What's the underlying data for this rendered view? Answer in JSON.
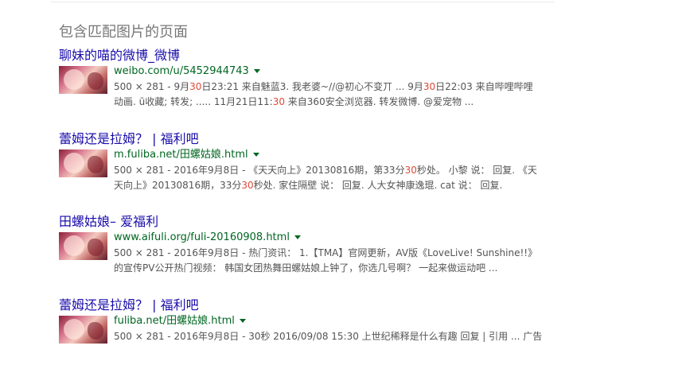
{
  "section_heading": "包含匹配图片的页面",
  "results": [
    {
      "title": "聊妹的喵的微博_微博",
      "url": "weibo.com/u/5452944743",
      "snippet_lines": [
        [
          {
            "t": "500 × 281 - 9月"
          },
          {
            "t": "30",
            "hl": true
          },
          {
            "t": "日23:21 来自魅蓝3. 我老婆~//@初心不变丌 ... 9月"
          },
          {
            "t": "30",
            "hl": true
          },
          {
            "t": "日22:03 来自哔哩哔哩"
          }
        ],
        [
          {
            "t": "动画. ũ收藏; 转发; ..... 11月21日11:"
          },
          {
            "t": "30",
            "hl": true
          },
          {
            "t": " 来自360安全浏览器. 转发微博. @爱宠物 ..."
          }
        ]
      ]
    },
    {
      "title": "蕾姆还是拉姆？ | 福利吧",
      "url": "m.fuliba.net/田螺姑娘.html",
      "snippet_lines": [
        [
          {
            "t": "500 × 281 - 2016年9月8日 - 《天天向上》20130816期，第33分"
          },
          {
            "t": "30",
            "hl": true
          },
          {
            "t": "秒处。 小黎 说： 回复. 《天"
          }
        ],
        [
          {
            "t": "天向上》20130816期，33分"
          },
          {
            "t": "30",
            "hl": true
          },
          {
            "t": "秒处. 家住隔壁 说： 回复. 人大女神康逸琨. cat 说： 回复."
          }
        ]
      ]
    },
    {
      "title": "田螺姑娘– 爱福利",
      "url": "www.aifuli.org/fuli-20160908.html",
      "snippet_lines": [
        [
          {
            "t": "500 × 281 - 2016年9月8日 - 热门资讯： 1.【TMA】官网更新，AV版《LoveLive! Sunshine!!》"
          }
        ],
        [
          {
            "t": "的宣传PV公开热门视频： 韩国女团热舞田螺姑娘上钟了，你选几号啊？ 一起来做运动吧 ..."
          }
        ]
      ]
    },
    {
      "title": "蕾姆还是拉姆？ | 福利吧",
      "url": "fuliba.net/田螺姑娘.html",
      "snippet_lines": [
        [
          {
            "t": "500 × 281 - 2016年9月8日 - 30秒 2016/09/08 15:30 上世纪稀释是什么有趣 回复 | 引用 ... 广告"
          }
        ]
      ]
    }
  ]
}
